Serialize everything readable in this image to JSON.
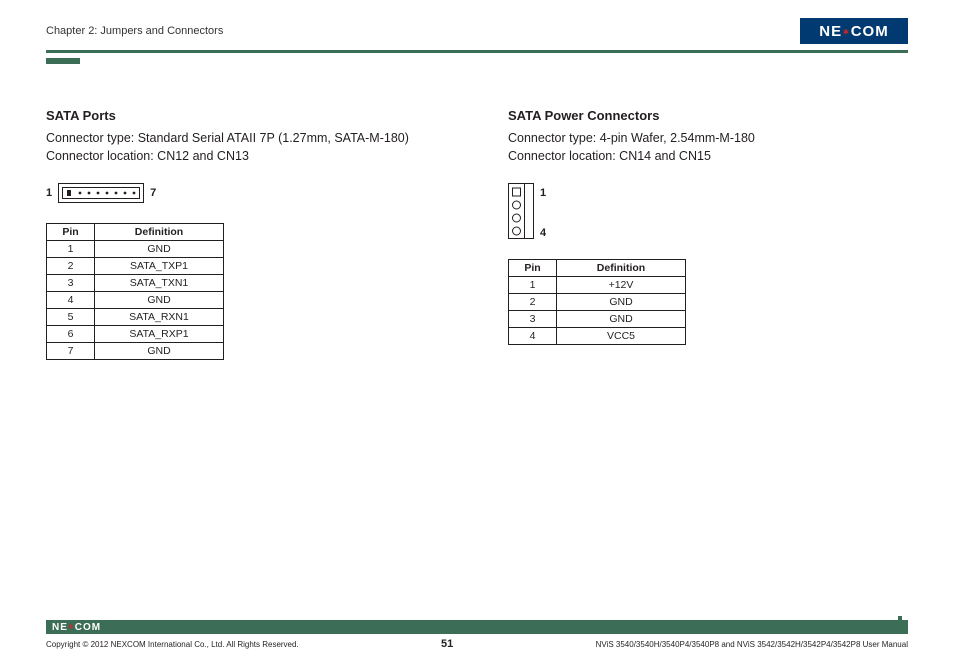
{
  "header": {
    "chapter": "Chapter 2: Jumpers and Connectors",
    "logo_text_pre": "NE",
    "logo_text_post": "COM"
  },
  "left": {
    "title": "SATA Ports",
    "desc_line1": "Connector type: Standard Serial ATAII 7P (1.27mm, SATA-M-180)",
    "desc_line2": "Connector location: CN12 and CN13",
    "pin_left": "1",
    "pin_right": "7",
    "table": {
      "h1": "Pin",
      "h2": "Definition",
      "rows": [
        {
          "pin": "1",
          "def": "GND"
        },
        {
          "pin": "2",
          "def": "SATA_TXP1"
        },
        {
          "pin": "3",
          "def": "SATA_TXN1"
        },
        {
          "pin": "4",
          "def": "GND"
        },
        {
          "pin": "5",
          "def": "SATA_RXN1"
        },
        {
          "pin": "6",
          "def": "SATA_RXP1"
        },
        {
          "pin": "7",
          "def": "GND"
        }
      ]
    }
  },
  "right": {
    "title": "SATA Power Connectors",
    "desc_line1": "Connector type: 4-pin Wafer, 2.54mm-M-180",
    "desc_line2": "Connector location: CN14 and CN15",
    "pin_top": "1",
    "pin_bot": "4",
    "table": {
      "h1": "Pin",
      "h2": "Definition",
      "rows": [
        {
          "pin": "1",
          "def": "+12V"
        },
        {
          "pin": "2",
          "def": "GND"
        },
        {
          "pin": "3",
          "def": "GND"
        },
        {
          "pin": "4",
          "def": "VCC5"
        }
      ]
    }
  },
  "footer": {
    "copyright": "Copyright © 2012 NEXCOM International Co., Ltd. All Rights Reserved.",
    "page": "51",
    "manual": "NViS 3540/3540H/3540P4/3540P8 and NViS 3542/3542H/3542P4/3542P8 User Manual",
    "logo_pre": "NE",
    "logo_post": "COM"
  }
}
